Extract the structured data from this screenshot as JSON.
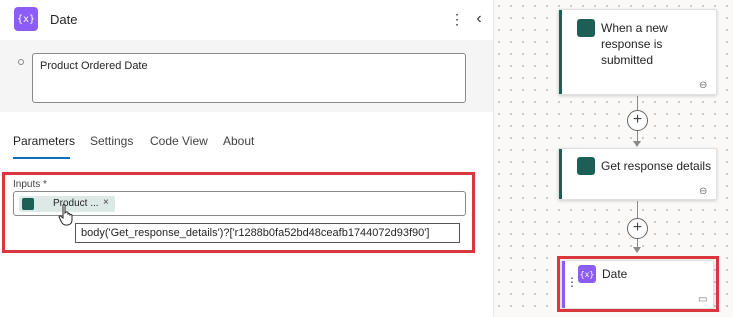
{
  "panel": {
    "title": "Date",
    "action_icon_glyph": "{x}",
    "kebab_glyph": "⋮",
    "collapse_glyph": "‹",
    "description": "Product Ordered Date",
    "tabs": [
      {
        "label": "Parameters",
        "active": true
      },
      {
        "label": "Settings",
        "active": false
      },
      {
        "label": "Code View",
        "active": false
      },
      {
        "label": "About",
        "active": false
      }
    ],
    "inputs": {
      "label": "Inputs *",
      "token": {
        "label": "Product ...",
        "close": "×",
        "icon": "forms-icon"
      },
      "tooltip": "body('Get_response_details')?['r1288b0fa52bd48ceafb1744072d93f90']"
    }
  },
  "canvas": {
    "cards": [
      {
        "title": "When a new response is submitted",
        "icon": "forms-icon",
        "link_icon": "link-icon",
        "link_glyph": "⊖"
      },
      {
        "title": "Get response details",
        "icon": "forms-icon",
        "link_icon": "link-icon",
        "link_glyph": "⊖"
      },
      {
        "title": "Date",
        "icon": "variable-icon",
        "icon_glyph": "{x}",
        "comment_icon": "comment-icon",
        "comment_glyph": "▭"
      }
    ],
    "plus_glyph": "+",
    "colors": {
      "forms": "#1b5f55",
      "variable": "#8b5cf6",
      "highlight": "#d9363e",
      "tab_accent": "#0f6cbd"
    }
  }
}
